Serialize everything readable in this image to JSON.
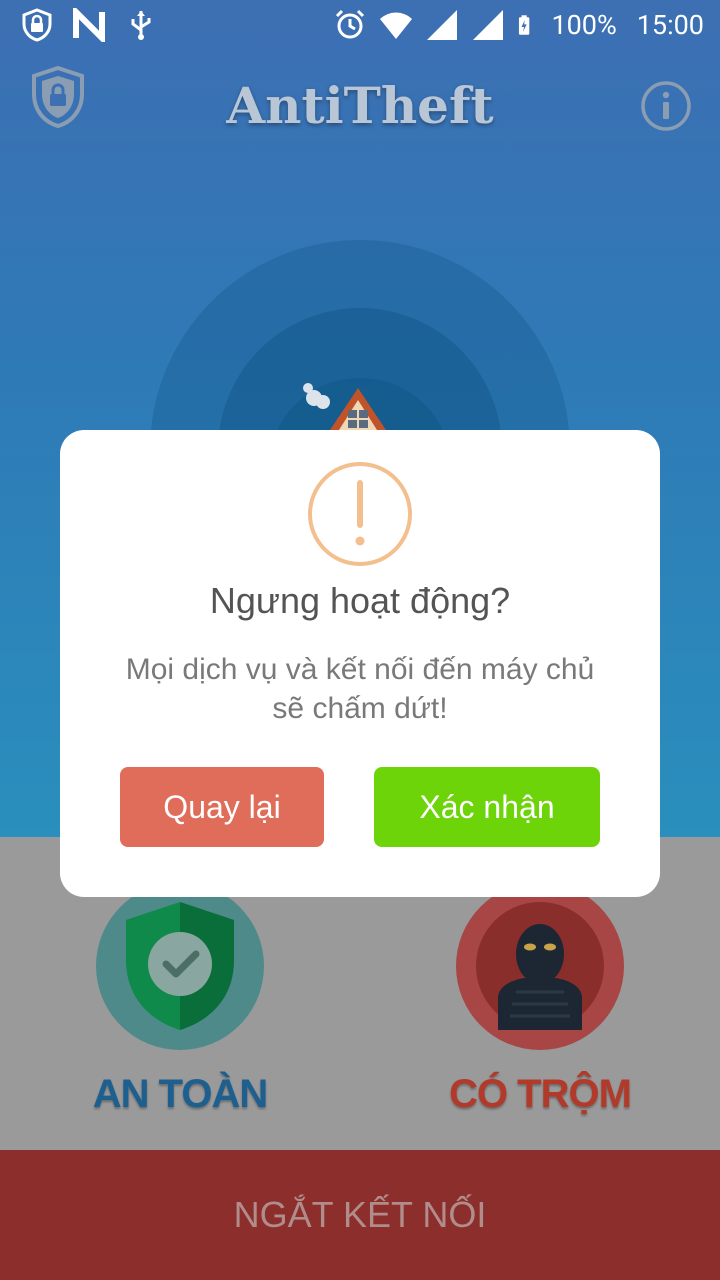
{
  "status_bar": {
    "battery": "100%",
    "time": "15:00"
  },
  "app": {
    "title": "AntiTheft"
  },
  "status_options": {
    "safe_label": "AN TOÀN",
    "thief_label": "CÓ TRỘM"
  },
  "bottom_bar": {
    "disconnect_label": "NGẮT KẾT NỐI"
  },
  "dialog": {
    "icon": "exclamation-circle-icon",
    "title": "Ngưng hoạt động?",
    "message": "Mọi dịch vụ và kết nối đến máy chủ sẽ chấm dứt!",
    "cancel_label": "Quay lại",
    "confirm_label": "Xác nhận"
  },
  "colors": {
    "cancel": "#e06d5a",
    "confirm": "#6dd40a",
    "warning_ring": "#f3bf8e",
    "disconnect_bar": "#8b2e2c"
  }
}
